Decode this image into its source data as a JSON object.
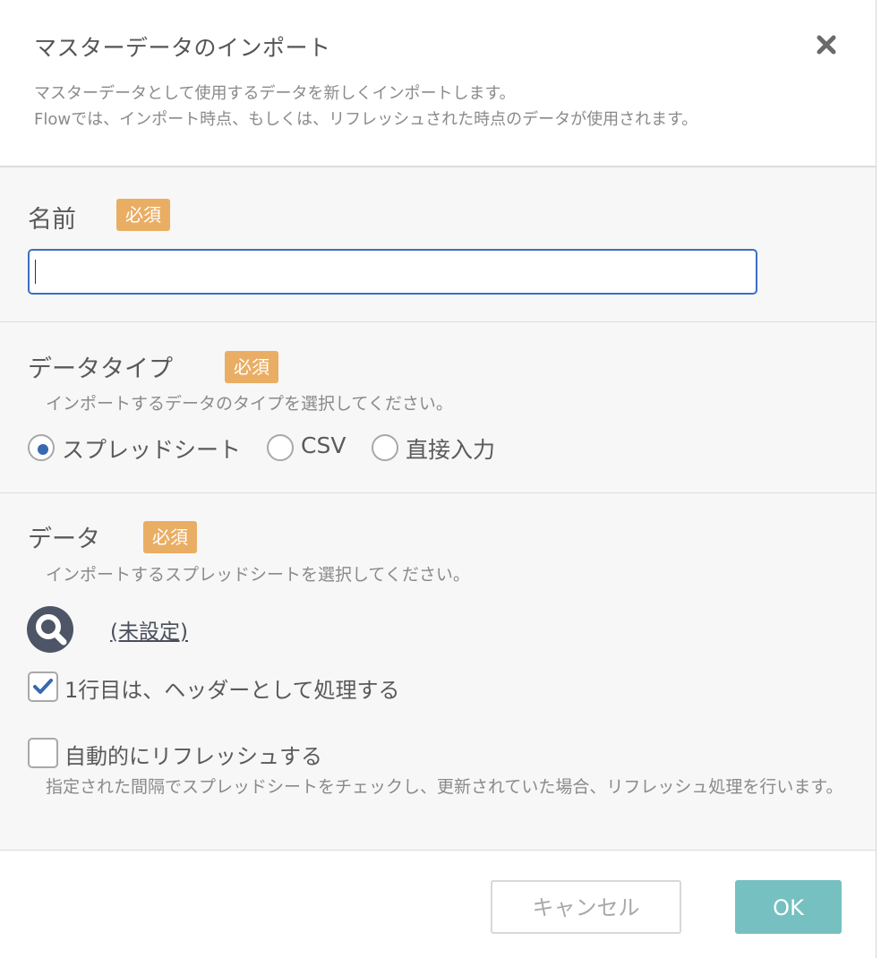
{
  "dialog": {
    "title": "マスターデータのインポート",
    "description_line1": "マスターデータとして使用するデータを新しくインポートします。",
    "description_line2": "Flowでは、インポート時点、もしくは、リフレッシュされた時点のデータが使用されます。"
  },
  "required_badge": "必須",
  "name_section": {
    "label": "名前",
    "input_value": ""
  },
  "datatype_section": {
    "label": "データタイプ",
    "hint": "インポートするデータのタイプを選択してください。",
    "options": [
      "スプレッドシート",
      "CSV",
      "直接入力"
    ],
    "selected": "スプレッドシート"
  },
  "data_section": {
    "label": "データ",
    "hint": "インポートするスプレッドシートを選択してください。",
    "link_text": "(未設定)",
    "header_checkbox_label": "1行目は、ヘッダーとして処理する",
    "header_checkbox_checked": true,
    "refresh_checkbox_label": "自動的にリフレッシュする",
    "refresh_checkbox_checked": false,
    "refresh_hint": "指定された間隔でスプレッドシートをチェックし、更新されていた場合、リフレッシュ処理を行います。"
  },
  "footer": {
    "cancel_label": "キャンセル",
    "ok_label": "OK"
  },
  "colors": {
    "badge": "#e9ae64",
    "accent_blue": "#3b6fc4",
    "ok_button": "#77c0c1",
    "search_icon_bg": "#4d5566"
  }
}
